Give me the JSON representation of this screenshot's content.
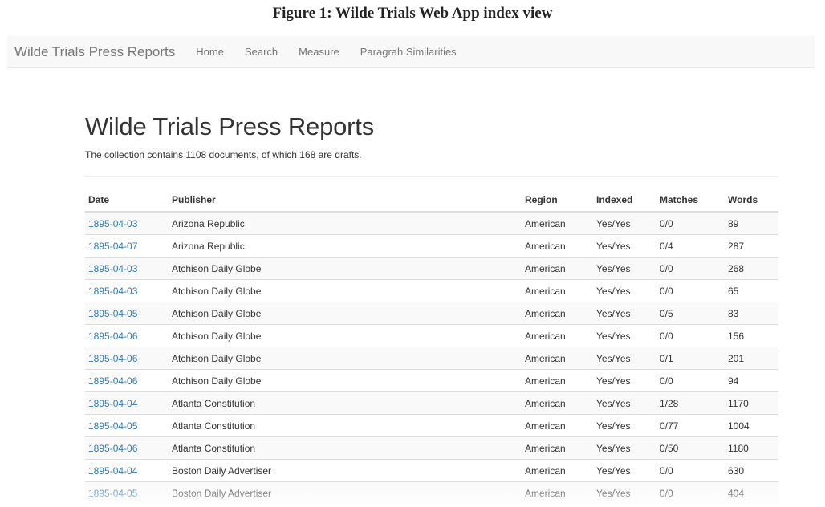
{
  "caption": "Figure 1: Wilde Trials Web App index view",
  "navbar": {
    "brand": "Wilde Trials Press Reports",
    "links": [
      "Home",
      "Search",
      "Measure",
      "Paragrah Similarities"
    ]
  },
  "main": {
    "title": "Wilde Trials Press Reports",
    "summary": "The collection contains 1108 documents, of which 168 are drafts.",
    "table": {
      "columns": [
        "Date",
        "Publisher",
        "Region",
        "Indexed",
        "Matches",
        "Words"
      ],
      "rows": [
        [
          "1895-04-03",
          "Arizona Republic",
          "American",
          "Yes/Yes",
          "0/0",
          "89"
        ],
        [
          "1895-04-07",
          "Arizona Republic",
          "American",
          "Yes/Yes",
          "0/4",
          "287"
        ],
        [
          "1895-04-03",
          "Atchison Daily Globe",
          "American",
          "Yes/Yes",
          "0/0",
          "268"
        ],
        [
          "1895-04-03",
          "Atchison Daily Globe",
          "American",
          "Yes/Yes",
          "0/0",
          "65"
        ],
        [
          "1895-04-05",
          "Atchison Daily Globe",
          "American",
          "Yes/Yes",
          "0/5",
          "83"
        ],
        [
          "1895-04-06",
          "Atchison Daily Globe",
          "American",
          "Yes/Yes",
          "0/0",
          "156"
        ],
        [
          "1895-04-06",
          "Atchison Daily Globe",
          "American",
          "Yes/Yes",
          "0/1",
          "201"
        ],
        [
          "1895-04-06",
          "Atchison Daily Globe",
          "American",
          "Yes/Yes",
          "0/0",
          "94"
        ],
        [
          "1895-04-04",
          "Atlanta Constitution",
          "American",
          "Yes/Yes",
          "1/28",
          "1170"
        ],
        [
          "1895-04-05",
          "Atlanta Constitution",
          "American",
          "Yes/Yes",
          "0/77",
          "1004"
        ],
        [
          "1895-04-06",
          "Atlanta Constitution",
          "American",
          "Yes/Yes",
          "0/50",
          "1180"
        ],
        [
          "1895-04-04",
          "Boston Daily Advertiser",
          "American",
          "Yes/Yes",
          "0/0",
          "630"
        ],
        [
          "1895-04-05",
          "Boston Daily Advertiser",
          "American",
          "Yes/Yes",
          "0/0",
          "404"
        ]
      ]
    }
  },
  "colors": {
    "link": "#337ab7",
    "navbar_bg": "#f8f8f8",
    "stripe": "#f9f9f9"
  }
}
